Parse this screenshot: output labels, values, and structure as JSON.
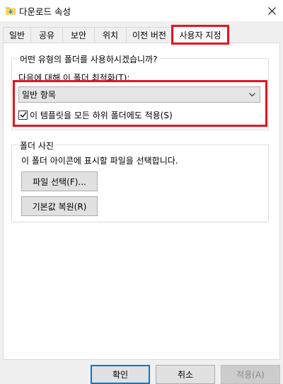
{
  "window": {
    "title": "다운로드 속성"
  },
  "tabs": [
    {
      "label": "일반"
    },
    {
      "label": "공유"
    },
    {
      "label": "보안"
    },
    {
      "label": "위치"
    },
    {
      "label": "이전 버전"
    },
    {
      "label": "사용자 지정",
      "active": true
    }
  ],
  "folder_type": {
    "group_label": "어떤 유형의 폴더를 사용하시겠습니까?",
    "optimize_label": "다음에 대해 이 폴더 최적화(T):",
    "selected_option": "일반 항목",
    "apply_subfolders_label": "이 템플릿을 모든 하위 폴더에도 적용(S)",
    "apply_subfolders_checked": true
  },
  "folder_picture": {
    "group_label": "폴더 사진",
    "description": "이 폴더 아이콘에 표시할 파일을 선택합니다.",
    "choose_file_label": "파일 선택(F)...",
    "restore_default_label": "기본값 복원(R)"
  },
  "footer": {
    "ok_label": "확인",
    "cancel_label": "취소",
    "apply_label": "적용(A)"
  },
  "colors": {
    "highlight": "#e5141f",
    "default_button_border": "#0078d7",
    "folder_icon": "#f4c542"
  }
}
